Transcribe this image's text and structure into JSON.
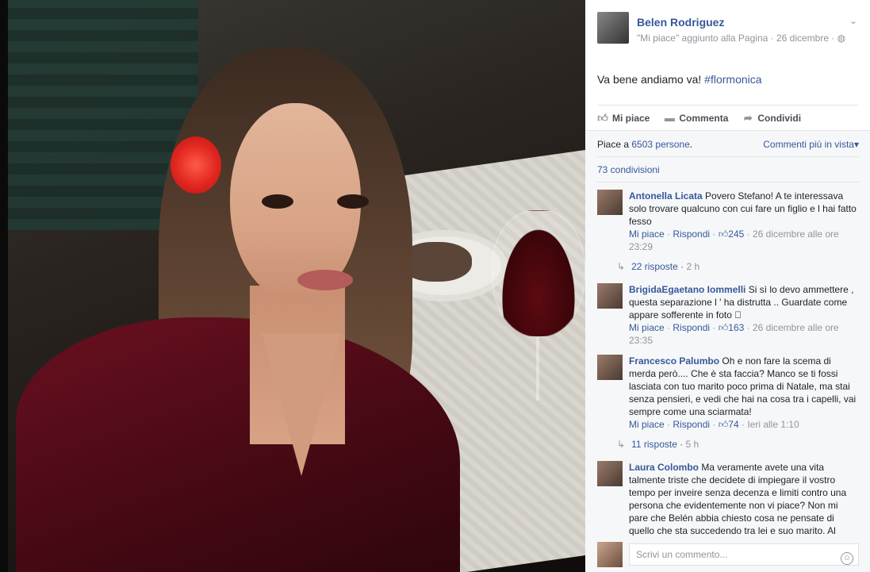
{
  "post": {
    "page_name": "Belen Rodriguez",
    "meta": "\"Mi piace\" aggiunto alla Pagina · 26 dicembre · ",
    "meta_icon": "globe-icon",
    "text_prefix": "Va bene andiamo va! ",
    "hashtag": "#flormonica"
  },
  "actions": {
    "like": "Mi piace",
    "comment": "Commenta",
    "share": "Condividi"
  },
  "ufi": {
    "likes_prefix": "Piace a ",
    "likes_count": "6503 persone",
    "likes_suffix": ".",
    "sort_label": "Commenti più in vista",
    "shares": "73 condivisioni"
  },
  "comments": [
    {
      "author": "Antonella Licata",
      "text": " Povero Stefano! A te interessava solo trovare qualcuno con cui fare un figlio e l hai fatto fesso",
      "like_label": "Mi piace",
      "reply_label": "Rispondi",
      "like_count": "245",
      "time": "26 dicembre alle ore 23:29",
      "replies": "22 risposte",
      "replies_time": "2 h"
    },
    {
      "author": "BrigidaEgaetano Iommelli",
      "text": " Si sì lo devo ammettere , questa separazione l ' ha distrutta .. Guardate come appare sofferente in foto 󾌱",
      "like_label": "Mi piace",
      "reply_label": "Rispondi",
      "like_count": "163",
      "time": "26 dicembre alle ore 23:35"
    },
    {
      "author": "Francesco Palumbo",
      "text": " Oh e non fare la scema di merda però.... Che è sta faccia? Manco se ti fossi lasciata con tuo marito poco prima di Natale, ma stai senza pensieri, e vedi che hai na cosa tra i capelli, vai sempre come una sciarmata!",
      "like_label": "Mi piace",
      "reply_label": "Rispondi",
      "like_count": "74",
      "time": "Ieri alle 1:10",
      "replies": "11 risposte",
      "replies_time": "5 h"
    },
    {
      "author": "Laura Colombo",
      "text": " Ma veramente avete una vita talmente triste che decidete di impiegare il vostro tempo per inveire senza decenza e limiti contro una persona che evidentemente non vi piace? Non mi pare che Belén abbia chiesto cosa ne pensate di quello che sta succedendo tra lei e suo marito. Al"
    }
  ],
  "composer": {
    "placeholder": "Scrivi un commento...",
    "emoji_icon": "smiley-icon"
  }
}
